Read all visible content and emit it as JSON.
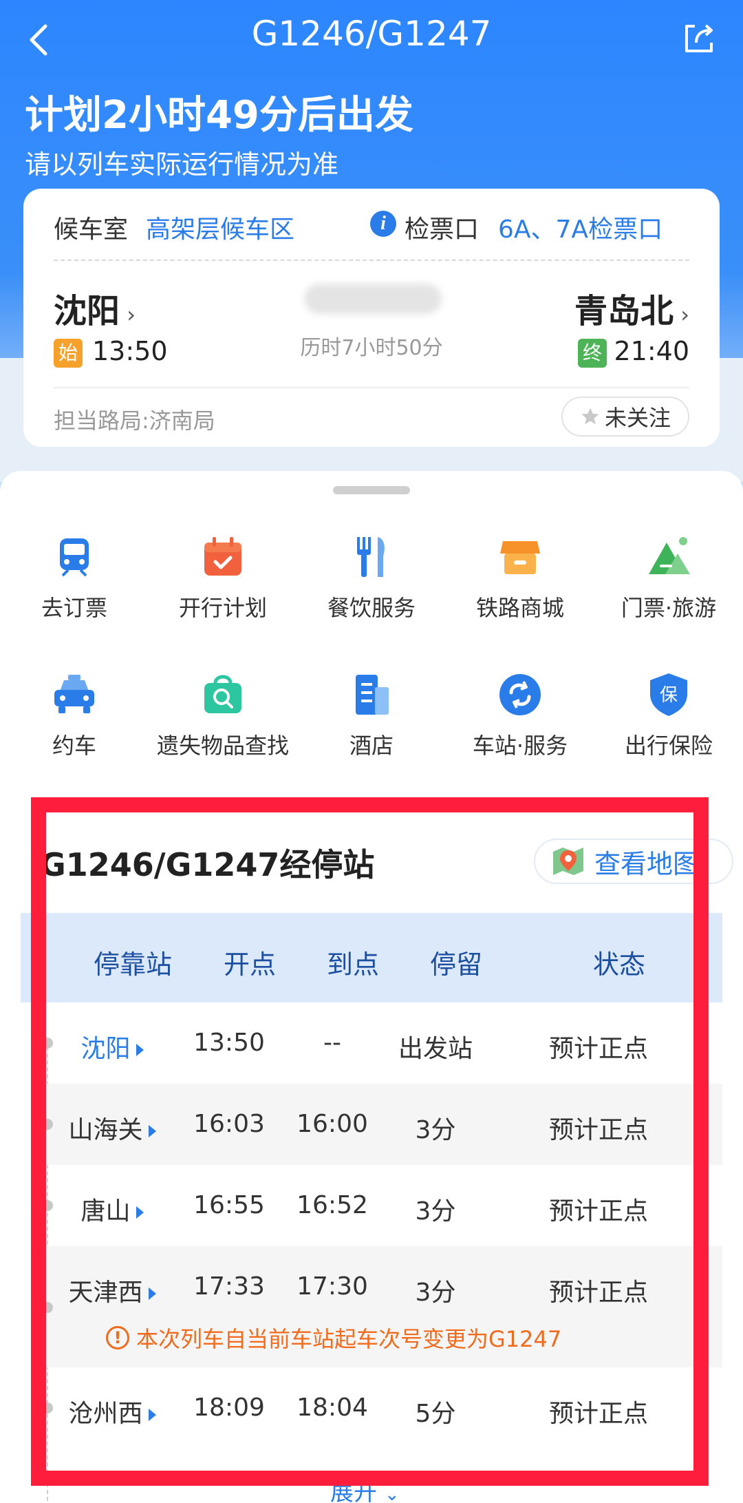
{
  "header": {
    "title": "G1246/G1247",
    "plan": "计划2小时49分后出发",
    "sub": "请以列车实际运行情况为准"
  },
  "info": {
    "wait_label": "候车室",
    "wait_value": "高架层候车区",
    "gate_label": "检票口",
    "gate_value": "6A、7A检票口",
    "from_station": "沈阳",
    "to_station": "青岛北",
    "from_badge": "始",
    "to_badge": "终",
    "from_time": "13:50",
    "to_time": "21:40",
    "duration": "历时7小时50分",
    "bureau": "担当路局:济南局",
    "follow": "未关注"
  },
  "services": [
    {
      "label": "去订票",
      "icon": "train-icon"
    },
    {
      "label": "开行计划",
      "icon": "calendar-icon"
    },
    {
      "label": "餐饮服务",
      "icon": "dining-icon"
    },
    {
      "label": "铁路商城",
      "icon": "shop-icon"
    },
    {
      "label": "门票·旅游",
      "icon": "mountain-icon"
    },
    {
      "label": "约车",
      "icon": "taxi-icon"
    },
    {
      "label": "遗失物品查找",
      "icon": "lost-bag-icon"
    },
    {
      "label": "酒店",
      "icon": "hotel-icon"
    },
    {
      "label": "车站·服务",
      "icon": "station-service-icon"
    },
    {
      "label": "出行保险",
      "icon": "insurance-icon"
    }
  ],
  "stops": {
    "title": "G1246/G1247经停站",
    "map_button": "查看地图",
    "headers": [
      "停靠站",
      "开点",
      "到点",
      "停留",
      "状态"
    ],
    "rows": [
      {
        "station": "沈阳",
        "depart": "13:50",
        "arrive": "--",
        "stay": "出发站",
        "status": "预计正点"
      },
      {
        "station": "山海关",
        "depart": "16:03",
        "arrive": "16:00",
        "stay": "3分",
        "status": "预计正点"
      },
      {
        "station": "唐山",
        "depart": "16:55",
        "arrive": "16:52",
        "stay": "3分",
        "status": "预计正点"
      },
      {
        "station": "天津西",
        "depart": "17:33",
        "arrive": "17:30",
        "stay": "3分",
        "status": "预计正点"
      },
      {
        "station": "沧州西",
        "depart": "18:09",
        "arrive": "18:04",
        "stay": "5分",
        "status": "预计正点"
      }
    ],
    "notice": "本次列车自当前车站起车次号变更为G1247",
    "expand": "展开"
  },
  "colors": {
    "accent": "#2a7de8",
    "highlight": "#ff1d3c",
    "notice": "#f26a1b"
  }
}
